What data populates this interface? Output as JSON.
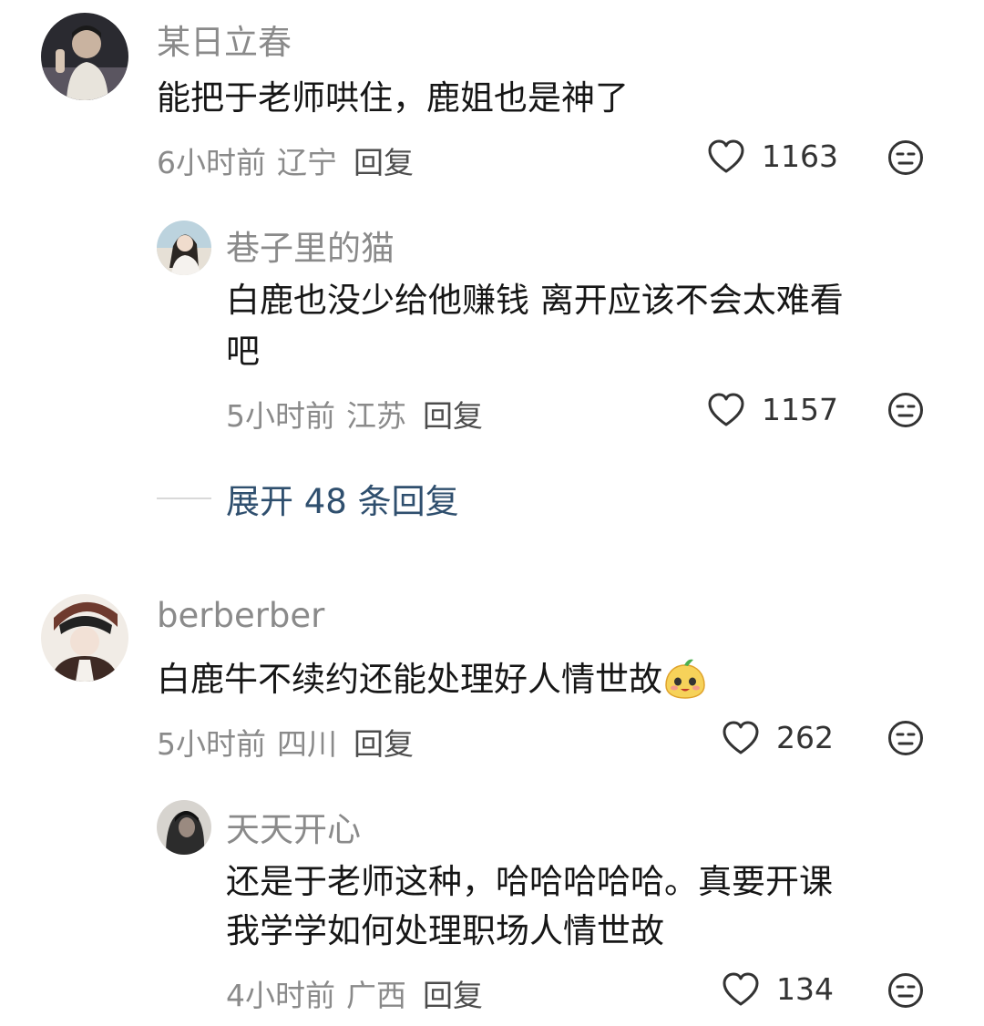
{
  "comments": [
    {
      "username": "某日立春",
      "text": "能把于老师哄住，鹿姐也是神了",
      "time": "6小时前",
      "location": "辽宁",
      "reply_label": "回复",
      "likes": "1163",
      "reply": {
        "username": "巷子里的猫",
        "text_line1": "白鹿也没少给他赚钱 离开应该不会太难看",
        "text_line2": "吧",
        "time": "5小时前",
        "location": "江苏",
        "reply_label": "回复",
        "likes": "1157"
      },
      "expand_label": "展开 48 条回复"
    },
    {
      "username": "berberber",
      "text": "白鹿牛不续约还能处理好人情世故",
      "time": "5小时前",
      "location": "四川",
      "reply_label": "回复",
      "likes": "262",
      "reply": {
        "username": "天天开心",
        "text_line1": "还是于老师这种，哈哈哈哈哈。真要开课",
        "text_line2": "我学学如何处理职场人情世故",
        "time": "4小时前",
        "location": "广西",
        "reply_label": "回复",
        "likes": "134"
      }
    }
  ],
  "icons": {
    "like": "heart-outline-icon",
    "dislike": "neutral-face-icon",
    "emoji": "mango-emoji-icon"
  },
  "colors": {
    "username": "#8a8a8a",
    "text": "#161616",
    "expand_link": "#2f4f6e"
  }
}
